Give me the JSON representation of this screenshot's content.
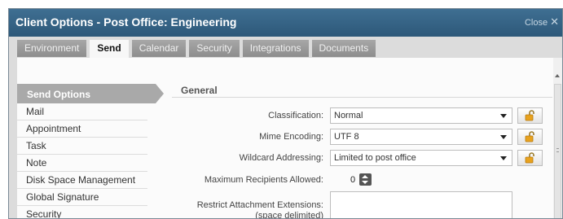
{
  "dialog": {
    "title": "Client Options - Post Office: Engineering",
    "close_label": "Close",
    "close_glyph": "✕"
  },
  "tabs": [
    {
      "label": "Environment",
      "active": false
    },
    {
      "label": "Send",
      "active": true
    },
    {
      "label": "Calendar",
      "active": false
    },
    {
      "label": "Security",
      "active": false
    },
    {
      "label": "Integrations",
      "active": false
    },
    {
      "label": "Documents",
      "active": false
    }
  ],
  "sidebar": {
    "title": "Send Options",
    "items": [
      "Mail",
      "Appointment",
      "Task",
      "Note",
      "Disk Space Management",
      "Global Signature",
      "Security"
    ]
  },
  "form": {
    "section_title": "General",
    "classification": {
      "label": "Classification:",
      "value": "Normal"
    },
    "mime_encoding": {
      "label": "Mime Encoding:",
      "value": "UTF 8"
    },
    "wildcard": {
      "label": "Wildcard Addressing:",
      "value": "Limited to post office"
    },
    "max_recipients": {
      "label": "Maximum Recipients Allowed:",
      "value": "0"
    },
    "restrict_ext": {
      "label_line1": "Restrict Attachment Extensions:",
      "label_line2": "(space delimited)",
      "value": ""
    }
  },
  "icons": {
    "lock": "unlock-icon",
    "dropdown": "caret-down-icon",
    "stepper": "spinner-icon"
  },
  "colors": {
    "titlebar": "#2d5879",
    "active_tab": "#f7f7f7",
    "inactive_tab": "#8d8d8d",
    "sidebar_selected": "#a9a9a9",
    "lock_icon": "#e8a21e"
  }
}
